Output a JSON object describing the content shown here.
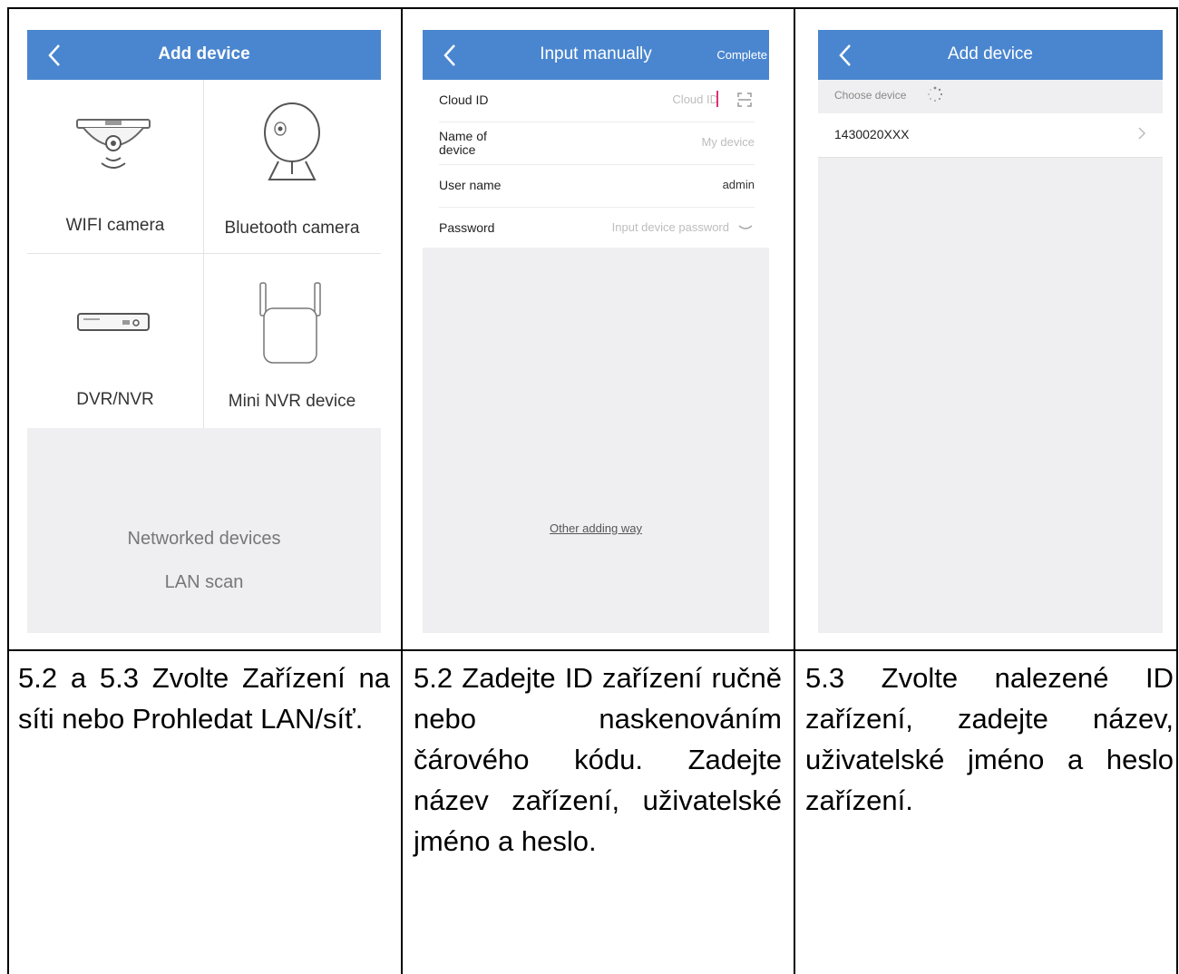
{
  "screens": {
    "add_device": {
      "title": "Add device",
      "tiles": [
        "WIFI camera",
        "Bluetooth camera",
        "DVR/NVR",
        "Mini NVR device"
      ],
      "networked_devices": "Networked devices",
      "lan_scan": "LAN scan"
    },
    "input_manually": {
      "title": "Input manually",
      "complete": "Complete",
      "fields": [
        {
          "label": "Cloud ID",
          "value": "Cloud ID"
        },
        {
          "label": "Name of device",
          "value": "My device"
        },
        {
          "label": "User name",
          "value": "admin"
        },
        {
          "label": "Password",
          "value": "Input device password"
        }
      ],
      "other_adding_way": "Other adding way"
    },
    "choose_device": {
      "title": "Add device",
      "choose_label": "Choose device",
      "device_id": "1430020XXX"
    }
  },
  "captions": [
    "5.2 a 5.3 Zvolte Zařízení na síti nebo Prohledat LAN/síť.",
    "5.2 Zadejte ID zařízení ručně nebo naskenováním čárového kódu. Zadejte název zařízení, uživatelské jméno a heslo.",
    "5.3 Zvolte nalezené ID zařízení, zadejte název, uživatelské jméno a heslo zařízení."
  ]
}
